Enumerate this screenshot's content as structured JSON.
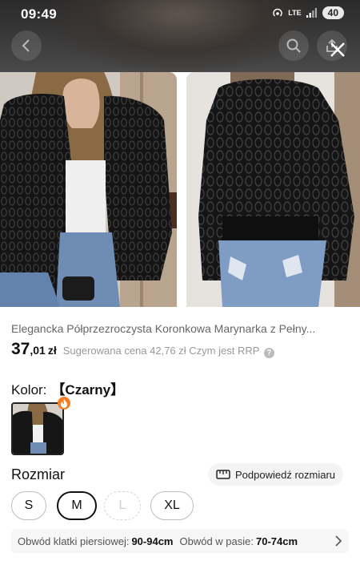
{
  "status_bar": {
    "time": "09:49",
    "network": "LTE",
    "battery": "40"
  },
  "icons": {
    "back": "chevron-left-icon",
    "search": "search-icon",
    "share": "share-icon",
    "close": "close-icon",
    "ruler": "ruler-icon",
    "fire": "fire-icon",
    "help": "question-icon"
  },
  "product": {
    "title": "Elegancka Półprzezroczysta Koronkowa Marynarka z Pełny...",
    "price_main": "37",
    "price_cents": ",01",
    "currency": "zł",
    "rrp_text": "Sugerowana cena 42,76 zł Czym jest RRP",
    "help_glyph": "?"
  },
  "color": {
    "label": "Kolor:",
    "value": "【Czarny】"
  },
  "size": {
    "label": "Rozmiar",
    "hint": "Podpowiedź rozmiaru",
    "options": [
      {
        "label": "S",
        "state": "available"
      },
      {
        "label": "M",
        "state": "selected"
      },
      {
        "label": "L",
        "state": "unavailable"
      },
      {
        "label": "XL",
        "state": "available"
      }
    ]
  },
  "measurements": {
    "chest_label": "Obwód klatki piersiowej:",
    "chest_value": "90-94cm",
    "waist_label": "Obwód w pasie:",
    "waist_value": "70-74cm"
  },
  "colors": {
    "accent": "#f57c1f",
    "text": "#222222",
    "muted": "#999999"
  }
}
